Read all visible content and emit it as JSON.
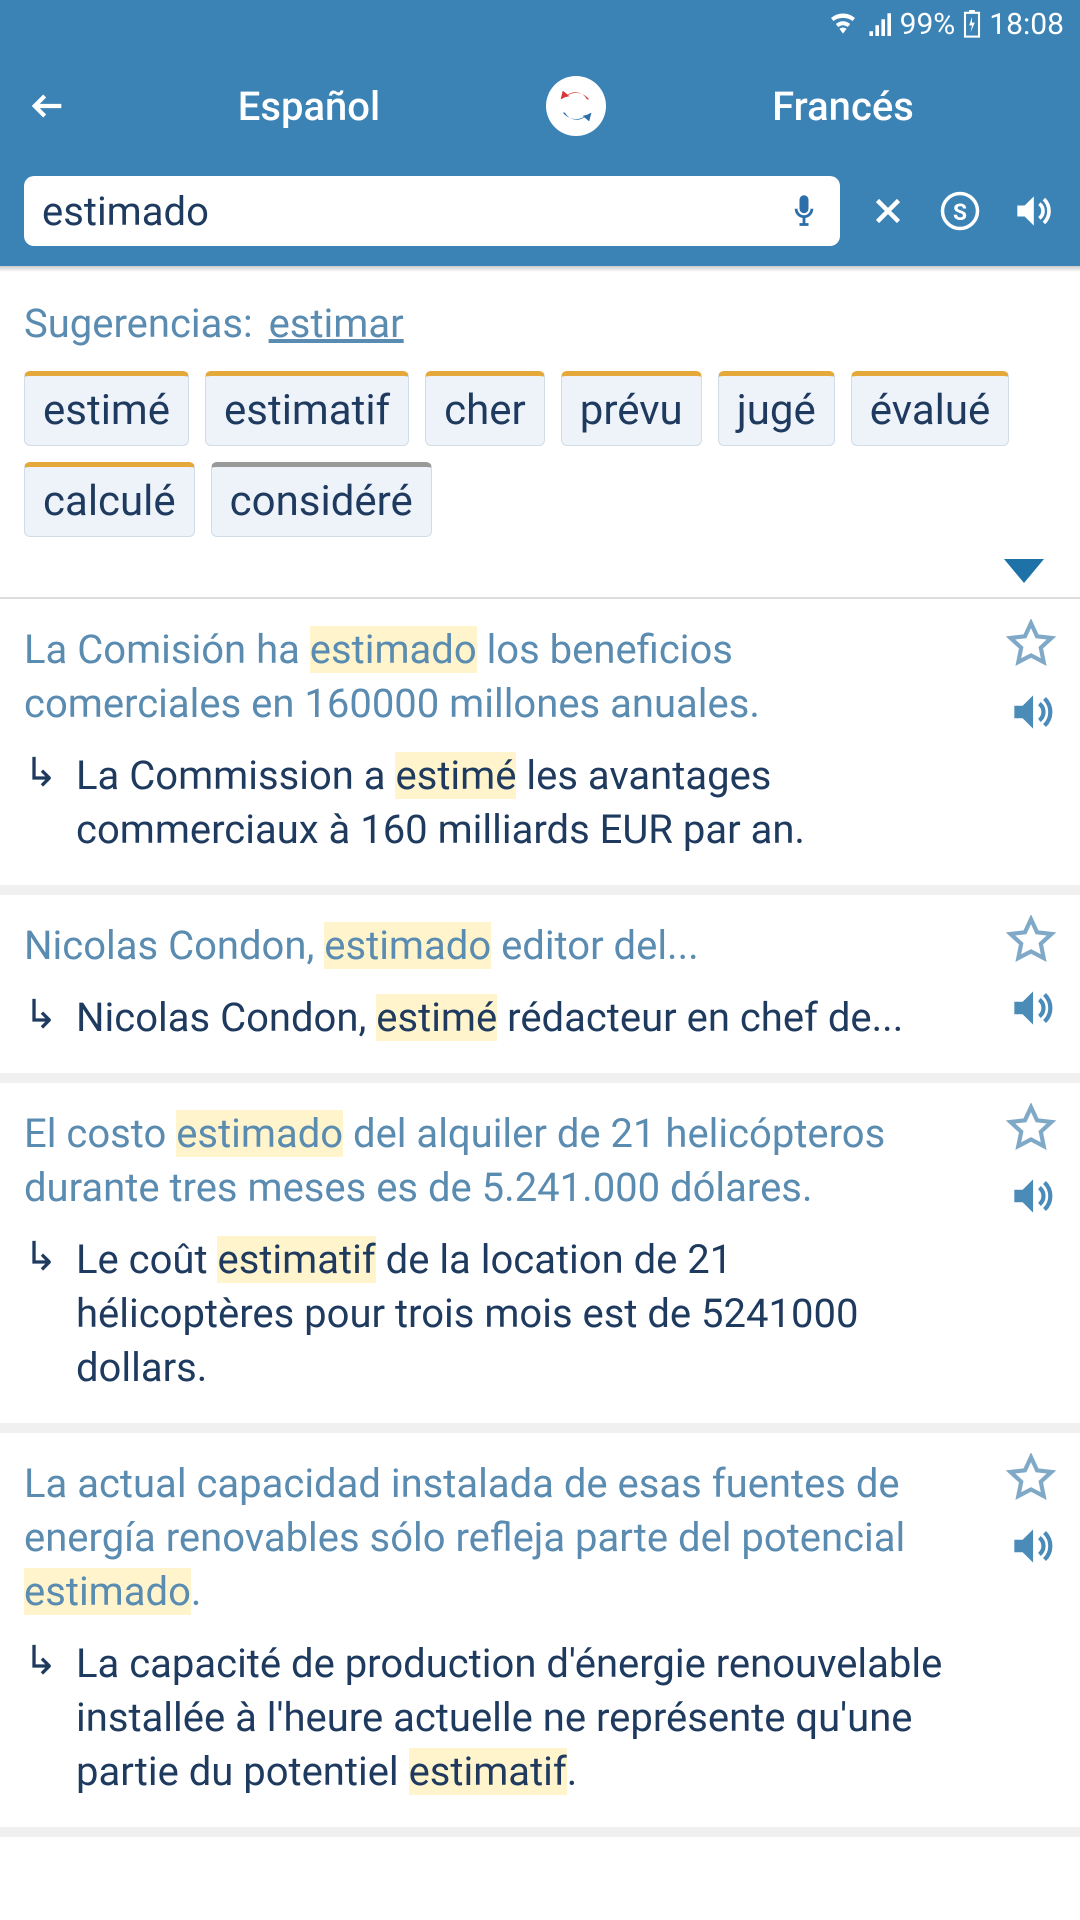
{
  "status": {
    "battery": "99%",
    "time": "18:08"
  },
  "header": {
    "lang_from": "Español",
    "lang_to": "Francés"
  },
  "search": {
    "query": "estimado"
  },
  "suggestions": {
    "label": "Sugerencias:",
    "link": "estimar",
    "chips": [
      {
        "text": "estimé",
        "gray": false
      },
      {
        "text": "estimatif",
        "gray": false
      },
      {
        "text": "cher",
        "gray": false
      },
      {
        "text": "prévu",
        "gray": false
      },
      {
        "text": "jugé",
        "gray": false
      },
      {
        "text": "évalué",
        "gray": false
      },
      {
        "text": "calculé",
        "gray": false
      },
      {
        "text": "considéré",
        "gray": true
      }
    ]
  },
  "results": [
    {
      "src_pre": "La Comisión ha ",
      "src_hl": "estimado",
      "src_post": " los beneficios comerciales en 160000 millones anuales.",
      "tgt_pre": "La Commission a ",
      "tgt_hl": "estimé",
      "tgt_post": " les avantages commerciaux à 160 milliards EUR par an."
    },
    {
      "src_pre": "Nicolas Condon, ",
      "src_hl": "estimado",
      "src_post": " editor del...",
      "tgt_pre": "Nicolas Condon, ",
      "tgt_hl": "estimé",
      "tgt_post": " rédacteur en chef de..."
    },
    {
      "src_pre": "El costo ",
      "src_hl": "estimado",
      "src_post": " del alquiler de 21 helicópteros durante tres meses es de 5.241.000 dólares.",
      "tgt_pre": "Le coût ",
      "tgt_hl": "estimatif",
      "tgt_post": " de la location de 21 hélicoptères pour trois mois est de 5241000 dollars."
    },
    {
      "src_pre": "La actual capacidad instalada de esas fuentes de energía renovables sólo refleja parte del potencial ",
      "src_hl": "estimado",
      "src_post": ".",
      "tgt_pre": "La capacité de production d'énergie renouvelable installée à l'heure actuelle ne représente qu'une partie du potentiel ",
      "tgt_hl": "estimatif",
      "tgt_post": "."
    }
  ]
}
